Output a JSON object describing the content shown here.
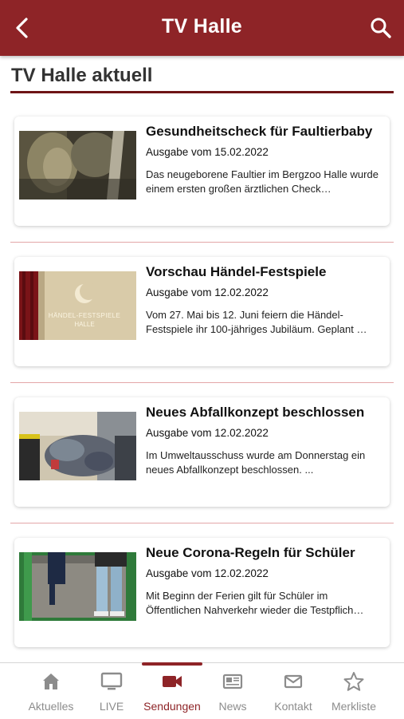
{
  "header": {
    "title": "TV Halle",
    "back_icon": "chevron-left-icon",
    "search_icon": "search-icon",
    "background": "#8e2427"
  },
  "section": {
    "title": "TV Halle aktuell"
  },
  "articles": [
    {
      "headline": "Gesundheitscheck für Faultierbaby",
      "date": "Ausgabe vom 15.02.2022",
      "teaser": "Das neugeborene Faultier im Bergzoo Halle wurde einem ersten großen ärztlichen Check…"
    },
    {
      "headline": "Vorschau Händel-Festspiele",
      "date": "Ausgabe vom 12.02.2022",
      "teaser": "Vom 27. Mai bis 12. Juni feiern die Händel-Festspiele ihr 100-jähriges Jubiläum. Geplant …",
      "image_text_1": "HÄNDEL-FESTSPIELE",
      "image_text_2": "HALLE"
    },
    {
      "headline": "Neues Abfallkonzept beschlossen",
      "date": "Ausgabe vom 12.02.2022",
      "teaser": "Im Umweltausschuss wurde am Donnerstag ein neues Abfallkonzept beschlossen. ..."
    },
    {
      "headline": "Neue Corona-Regeln für Schüler",
      "date": "Ausgabe vom 12.02.2022",
      "teaser": "Mit Beginn der Ferien gilt für Schüler im Öffentlichen Nahverkehr wieder die Testpflich…"
    }
  ],
  "nav": {
    "active": "Sendungen",
    "accent": "#8e2427",
    "items": [
      {
        "label": "Aktuelles",
        "icon": "home-icon"
      },
      {
        "label": "LIVE",
        "icon": "tv-icon"
      },
      {
        "label": "Sendungen",
        "icon": "video-camera-icon"
      },
      {
        "label": "News",
        "icon": "newspaper-icon"
      },
      {
        "label": "Kontakt",
        "icon": "mail-icon"
      },
      {
        "label": "Merkliste",
        "icon": "star-icon"
      }
    ]
  }
}
